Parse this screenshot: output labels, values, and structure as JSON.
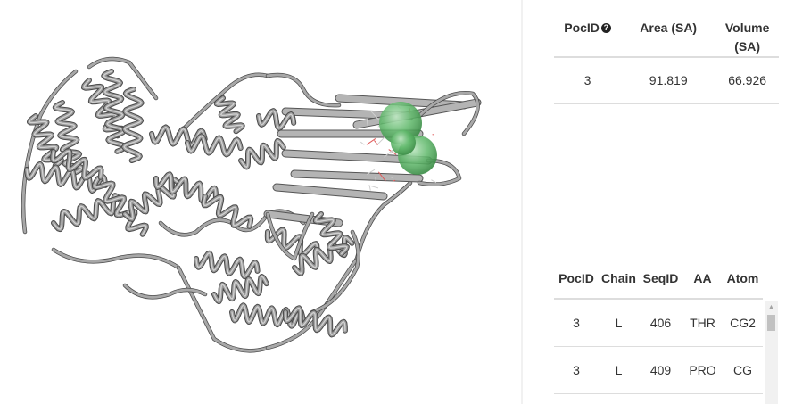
{
  "viewer": {
    "name": "protein-structure-viewer",
    "ribbon_color": "#9a9a9a",
    "pocket_color": "#5fb86a"
  },
  "pocket_table": {
    "headers": [
      "PocID",
      "Area (SA)",
      "Volume (SA)"
    ],
    "help_icon": "question-circle-icon",
    "rows": [
      {
        "pocid": "3",
        "area": "91.819",
        "volume": "66.926"
      }
    ]
  },
  "residue_table": {
    "headers": [
      "PocID",
      "Chain",
      "SeqID",
      "AA",
      "Atom"
    ],
    "rows": [
      {
        "pocid": "3",
        "chain": "L",
        "seqid": "406",
        "aa": "THR",
        "atom": "CG2"
      },
      {
        "pocid": "3",
        "chain": "L",
        "seqid": "409",
        "aa": "PRO",
        "atom": "CG"
      }
    ]
  },
  "colors": {
    "border": "#dddddd",
    "text": "#333333"
  }
}
